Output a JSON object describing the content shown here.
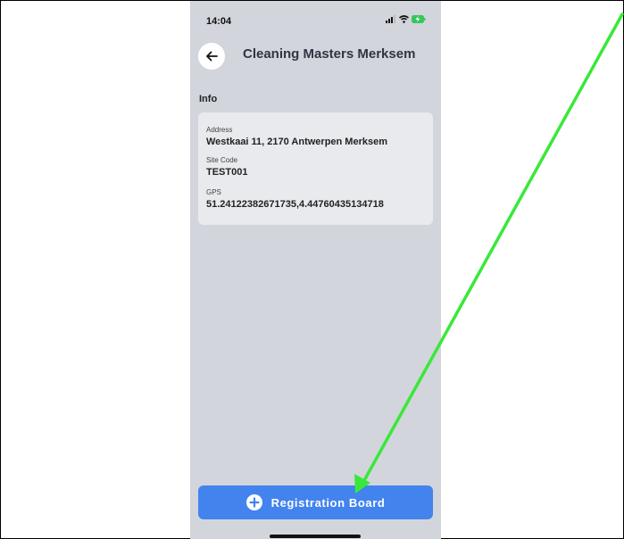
{
  "status_bar": {
    "time": "14:04",
    "icons": [
      "signal-icon",
      "wifi-icon",
      "battery-charging-icon"
    ]
  },
  "header": {
    "back_icon": "arrow-left-icon",
    "title": "Cleaning Masters Merksem"
  },
  "info": {
    "section_title": "Info",
    "fields": [
      {
        "label": "Address",
        "value": "Westkaai 11, 2170 Antwerpen Merksem"
      },
      {
        "label": "Site Code",
        "value": "TEST001"
      },
      {
        "label": "GPS",
        "value": "51.24122382671735,4.44760435134718"
      }
    ]
  },
  "action": {
    "icon": "plus-circle-icon",
    "label": "Registration Board"
  },
  "colors": {
    "background": "#d3d5dc",
    "card": "#e9eaee",
    "primary_button": "#4383ee",
    "annotation_arrow": "#39e83a"
  },
  "annotation": {
    "type": "arrow",
    "points_to": "registration-board-button"
  }
}
